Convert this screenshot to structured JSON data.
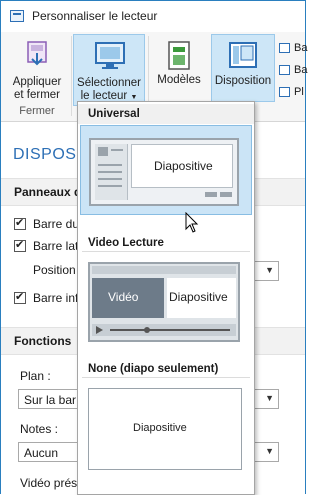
{
  "window": {
    "title": "Personnaliser le lecteur"
  },
  "ribbon": {
    "apply_label_1": "Appliquer",
    "apply_label_2": "et fermer",
    "group_fermer": "Fermer",
    "select_player_1": "Sélectionner",
    "select_player_2": "le lecteur",
    "models": "Modèles",
    "layout": "Disposition",
    "small": [
      "Ba",
      "Ba",
      "Pl"
    ]
  },
  "panel": {
    "title": "DISPOSIT",
    "section_panels": "Panneaux d",
    "cb1": "Barre du",
    "cb2": "Barre lat",
    "position_label": "Position",
    "cb3": "Barre inf",
    "section_functions": "Fonctions",
    "plan_label": "Plan :",
    "plan_value": "Sur la bar",
    "notes_label": "Notes :",
    "notes_value": "Aucun",
    "video_label": "Vidéo présentateur :"
  },
  "dropdown": {
    "h_universal": "Universal",
    "h_video": "Video Lecture",
    "h_none": "None (diapo seulement)",
    "slide": "Diapositive",
    "video": "Vidéo"
  },
  "colors": {
    "accent": "#2d6fb5",
    "selected": "#cbe4f6"
  }
}
